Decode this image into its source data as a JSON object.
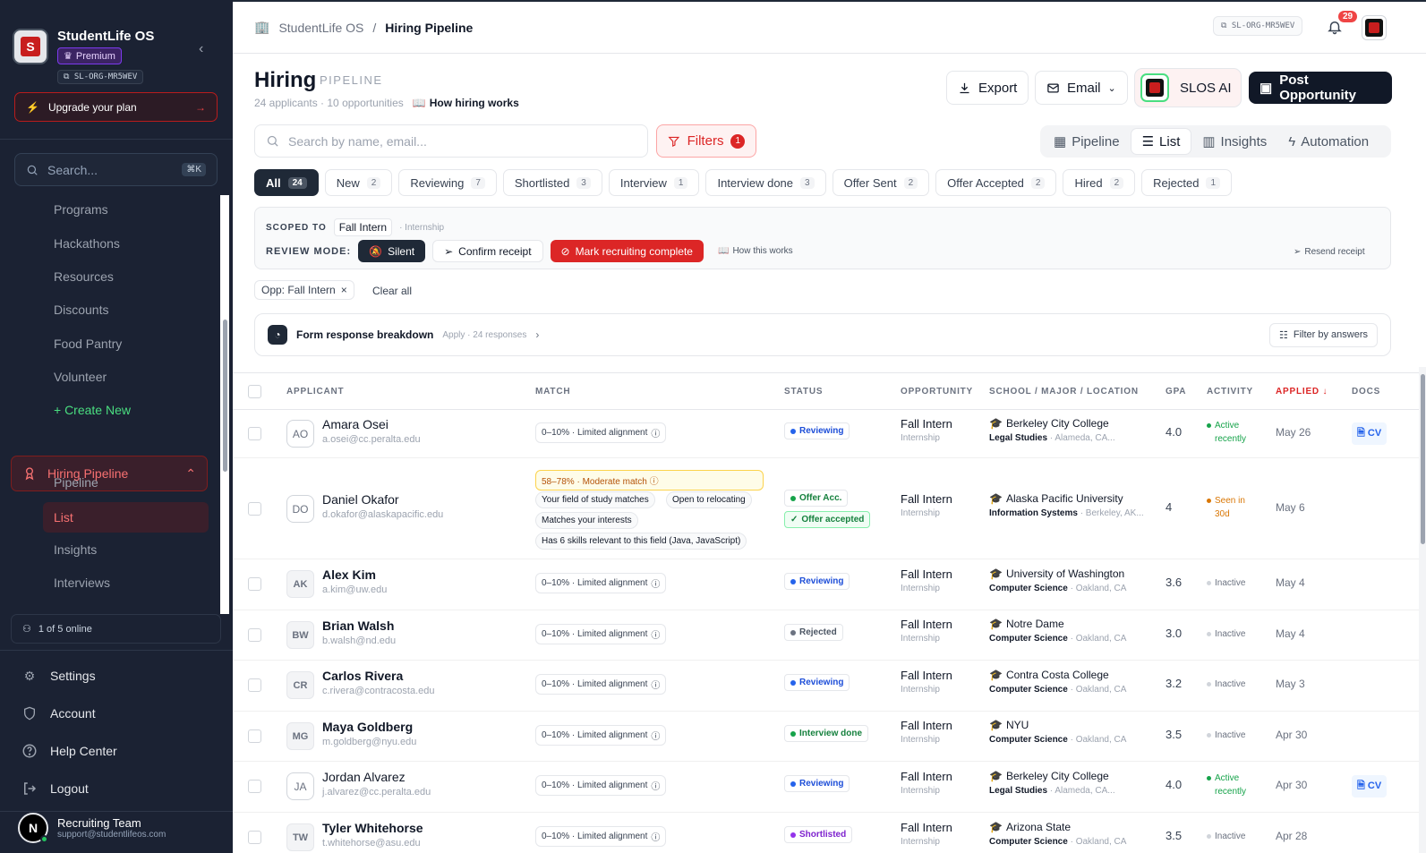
{
  "sidebar": {
    "brand": "StudentLife OS",
    "premium": "Premium",
    "org_id": "SL-ORG-MR5WEV",
    "upgrade": "Upgrade your plan",
    "search_placeholder": "Search...",
    "search_kbd": "⌘K",
    "nav": [
      "Programs",
      "Hackathons",
      "Resources",
      "Discounts",
      "Food Pantry",
      "Volunteer"
    ],
    "create_new": "+ Create New",
    "hiring_pipeline": "Hiring Pipeline",
    "sub": [
      "Pipeline",
      "List",
      "Insights",
      "Interviews"
    ],
    "online": "1 of 5 online",
    "bottom": [
      "Settings",
      "Account",
      "Help Center",
      "Logout"
    ],
    "user_initial": "N",
    "user_name": "Recruiting Team",
    "user_email": "support@studentlifeos.com"
  },
  "topbar": {
    "crumb_root": "StudentLife OS",
    "crumb_sep": "/",
    "crumb_current": "Hiring Pipeline",
    "org_id": "SL-ORG-MR5WEV",
    "notifications": "29"
  },
  "header": {
    "title": "Hiring",
    "subtitle": "PIPELINE",
    "meta": "24 applicants · 10 opportunities",
    "how": "How hiring works",
    "export": "Export",
    "email": "Email",
    "ai": "SLOS AI",
    "post": "Post Opportunity"
  },
  "toolbar": {
    "search_placeholder": "Search by name, email...",
    "filters": "Filters",
    "filters_count": "1",
    "views": [
      "Pipeline",
      "List",
      "Insights",
      "Automation"
    ]
  },
  "status_tabs": [
    {
      "label": "All",
      "count": "24"
    },
    {
      "label": "New",
      "count": "2"
    },
    {
      "label": "Reviewing",
      "count": "7"
    },
    {
      "label": "Shortlisted",
      "count": "3"
    },
    {
      "label": "Interview",
      "count": "1"
    },
    {
      "label": "Interview done",
      "count": "3"
    },
    {
      "label": "Offer Sent",
      "count": "2"
    },
    {
      "label": "Offer Accepted",
      "count": "2"
    },
    {
      "label": "Hired",
      "count": "2"
    },
    {
      "label": "Rejected",
      "count": "1"
    }
  ],
  "scope": {
    "label": "SCOPED TO",
    "opp": "Fall Intern",
    "kind": "· Internship",
    "review_label": "REVIEW MODE:",
    "silent": "Silent",
    "confirm": "Confirm receipt",
    "mark": "Mark recruiting complete",
    "how": "How this works",
    "resend": "Resend receipt"
  },
  "filter_chip": "Opp: Fall Intern",
  "clear_all": "Clear all",
  "breakdown": {
    "title": "Form response breakdown",
    "sub": "Apply · 24 responses",
    "filter": "Filter by answers"
  },
  "columns": [
    "APPLICANT",
    "MATCH",
    "STATUS",
    "OPPORTUNITY",
    "SCHOOL / MAJOR / LOCATION",
    "GPA",
    "ACTIVITY",
    "APPLIED ↓",
    "DOCS"
  ],
  "match_limited": "0–10% · Limited alignment",
  "rows": [
    {
      "init": "AO",
      "name": "Amara Osei",
      "email": "a.osei@cc.peralta.edu",
      "status": "Reviewing",
      "opp": "Fall Intern",
      "opp_type": "Internship",
      "school": "Berkeley City College",
      "major": "Legal Studies",
      "loc": " · Alameda, CA...",
      "gpa": "4.0",
      "act1": "Active",
      "act2": "recently",
      "applied": "May 26",
      "docs": "CV"
    },
    {
      "init": "DO",
      "name": "Daniel Okafor",
      "email": "d.okafor@alaskapacific.edu",
      "match": "58–78% · Moderate match",
      "tags": [
        "Your field of study matches",
        "Open to relocating",
        "Matches your interests",
        "Has 6 skills relevant to this field (Java, JavaScript)"
      ],
      "status": "Offer Acc.",
      "status2": "Offer accepted",
      "opp": "Fall Intern",
      "opp_type": "Internship",
      "school": "Alaska Pacific University",
      "major": "Information Systems",
      "loc": " · Berkeley, AK...",
      "gpa": "4",
      "act1": "Seen in",
      "act2": "30d",
      "applied": "May 6"
    },
    {
      "init": "AK",
      "name": "Alex Kim",
      "email": "a.kim@uw.edu",
      "status": "Reviewing",
      "opp": "Fall Intern",
      "opp_type": "Internship",
      "school": "University of Washington",
      "major": "Computer Science",
      "loc": " · Oakland, CA",
      "gpa": "3.6",
      "act1": "Inactive",
      "applied": "May 4"
    },
    {
      "init": "BW",
      "name": "Brian Walsh",
      "email": "b.walsh@nd.edu",
      "status": "Rejected",
      "opp": "Fall Intern",
      "opp_type": "Internship",
      "school": "Notre Dame",
      "major": "Computer Science",
      "loc": " · Oakland, CA",
      "gpa": "3.0",
      "act1": "Inactive",
      "applied": "May 4"
    },
    {
      "init": "CR",
      "name": "Carlos Rivera",
      "email": "c.rivera@contracosta.edu",
      "status": "Reviewing",
      "opp": "Fall Intern",
      "opp_type": "Internship",
      "school": "Contra Costa College",
      "major": "Computer Science",
      "loc": " · Oakland, CA",
      "gpa": "3.2",
      "act1": "Inactive",
      "applied": "May 3"
    },
    {
      "init": "MG",
      "name": "Maya Goldberg",
      "email": "m.goldberg@nyu.edu",
      "status": "Interview done",
      "opp": "Fall Intern",
      "opp_type": "Internship",
      "school": "NYU",
      "major": "Computer Science",
      "loc": " · Oakland, CA",
      "gpa": "3.5",
      "act1": "Inactive",
      "applied": "Apr 30"
    },
    {
      "init": "JA",
      "name": "Jordan Alvarez",
      "email": "j.alvarez@cc.peralta.edu",
      "status": "Reviewing",
      "opp": "Fall Intern",
      "opp_type": "Internship",
      "school": "Berkeley City College",
      "major": "Legal Studies",
      "loc": " · Alameda, CA...",
      "gpa": "4.0",
      "act1": "Active",
      "act2": "recently",
      "applied": "Apr 30",
      "docs": "CV"
    },
    {
      "init": "TW",
      "name": "Tyler Whitehorse",
      "email": "t.whitehorse@asu.edu",
      "status": "Shortlisted",
      "opp": "Fall Intern",
      "opp_type": "Internship",
      "school": "Arizona State",
      "major": "Computer Science",
      "loc": " · Oakland, CA",
      "gpa": "3.5",
      "act1": "Inactive",
      "applied": "Apr 28"
    }
  ],
  "colors": {
    "sidebar": "#1b2233",
    "accent": "#dc2626",
    "reviewing": "#2563eb",
    "offer": "#16a34a",
    "interview_done": "#16a34a",
    "shortlisted": "#9333ea",
    "rejected": "#6b7280"
  }
}
